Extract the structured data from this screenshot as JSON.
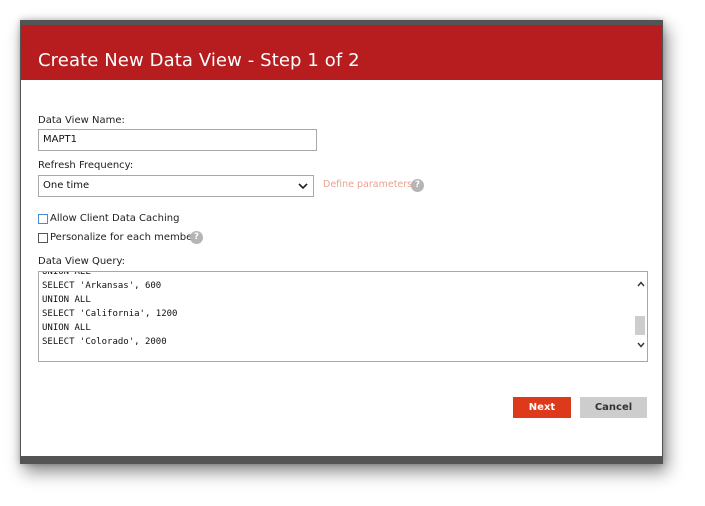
{
  "dialog": {
    "title": "Create New Data View - Step 1 of 2"
  },
  "form": {
    "name_label": "Data View Name:",
    "name_value": "MAPT1",
    "refresh_label": "Refresh Frequency:",
    "refresh_value": "One time",
    "define_link": "Define parameters...",
    "help_glyph": "?",
    "allow_caching_label": "Allow Client Data Caching",
    "allow_caching_checked": false,
    "personalize_label": "Personalize for each member",
    "personalize_checked": false,
    "query_label": "Data View Query:",
    "query_lines": [
      "UNION ALL",
      "SELECT 'Arkansas', 600",
      "UNION ALL",
      "SELECT 'California', 1200",
      "UNION ALL",
      "SELECT 'Colorado', 2000"
    ]
  },
  "buttons": {
    "next": "Next",
    "cancel": "Cancel"
  },
  "colors": {
    "header": "#b71c1f",
    "primary_button": "#dc3a1a",
    "secondary_button": "#cdcdcd",
    "link": "#e8a38f"
  },
  "icons": {
    "help": "help-icon",
    "dropdown": "chevron-down-icon",
    "scroll_up": "chevron-up-icon",
    "scroll_down": "chevron-down-icon"
  }
}
